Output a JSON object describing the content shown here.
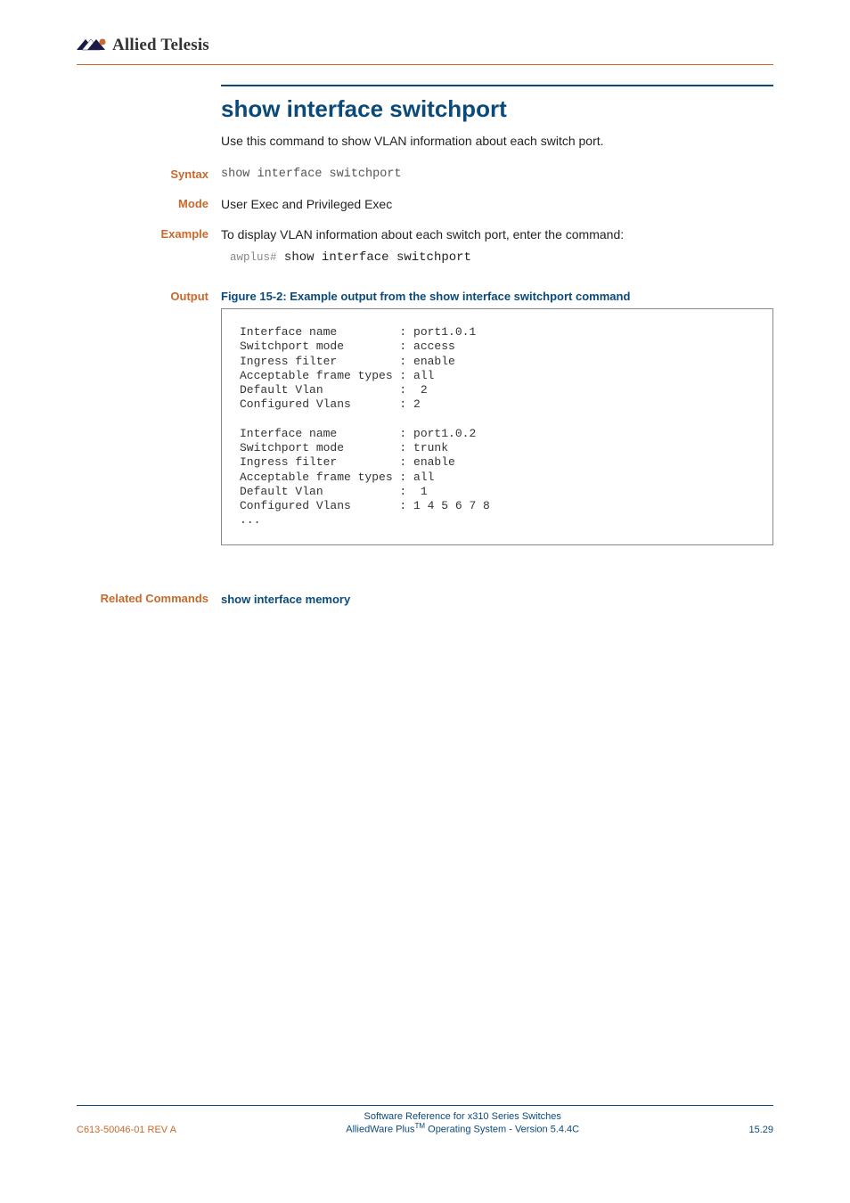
{
  "header": {
    "logo_text": "Allied Telesis"
  },
  "title": "show interface switchport",
  "intro": "Use this command to show VLAN information about each switch port.",
  "rows": {
    "syntax": {
      "label": "Syntax",
      "value": "show interface switchport"
    },
    "mode": {
      "label": "Mode",
      "value": "User Exec and Privileged Exec"
    },
    "example": {
      "label": "Example",
      "text": "To display VLAN information about each switch port, enter the command:",
      "prompt": "awplus#",
      "cmd": "show interface switchport"
    },
    "output": {
      "label": "Output",
      "caption": "Figure 15-2: Example output from the show interface switchport command",
      "text": "Interface name         : port1.0.1\nSwitchport mode        : access\nIngress filter         : enable\nAcceptable frame types : all\nDefault Vlan           :  2\nConfigured Vlans       : 2\n\nInterface name         : port1.0.2\nSwitchport mode        : trunk\nIngress filter         : enable\nAcceptable frame types : all\nDefault Vlan           :  1\nConfigured Vlans       : 1 4 5 6 7 8\n..."
    },
    "related": {
      "label": "Related Commands",
      "link": "show interface memory"
    }
  },
  "footer": {
    "left": "C613-50046-01 REV A",
    "center1": "Software Reference for x310 Series Switches",
    "center2a": "AlliedWare Plus",
    "center2b": " Operating System - Version 5.4.4C",
    "tm": "TM",
    "right": "15.29"
  }
}
